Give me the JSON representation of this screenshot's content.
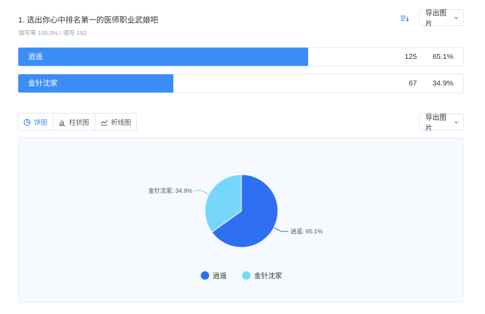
{
  "question": {
    "title": "1. 选出你心中排名第一的医师职业武娘吧",
    "meta": "填写率 100.0% / 填写 192"
  },
  "toolbar": {
    "export_label": "导出图片",
    "sort_icon": "sort-icon",
    "chevron_icon": "chevron-down-icon"
  },
  "results": [
    {
      "label": "逍遥",
      "count": "125",
      "percent": "65.1%",
      "fraction": 0.651
    },
    {
      "label": "金针沈家",
      "count": "67",
      "percent": "34.9%",
      "fraction": 0.349
    }
  ],
  "tabs": [
    {
      "label": "饼图",
      "icon": "pie-icon",
      "active": true
    },
    {
      "label": "柱状图",
      "icon": "bar-chart-icon",
      "active": false
    },
    {
      "label": "折线图",
      "icon": "line-chart-icon",
      "active": false
    }
  ],
  "colors": {
    "bar_fill": "#3a8ef6",
    "accent": "#3a8ef6",
    "pie_series_1": "#2f6ff2",
    "pie_series_2": "#76d6fb"
  },
  "chart_data": {
    "type": "pie",
    "categories": [
      "逍遥",
      "金针沈家"
    ],
    "values": [
      65.1,
      34.9
    ],
    "slice_labels": [
      "逍遥: 65.1%",
      "金针沈家: 34.9%"
    ],
    "legend": [
      "逍遥",
      "金针沈家"
    ],
    "legend_position": "bottom"
  }
}
